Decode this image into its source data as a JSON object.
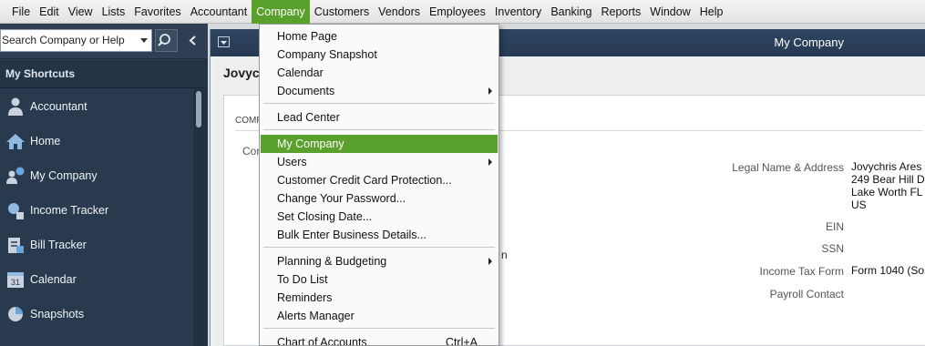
{
  "menubar": {
    "items": [
      "File",
      "Edit",
      "View",
      "Lists",
      "Favorites",
      "Accountant",
      "Company",
      "Customers",
      "Vendors",
      "Employees",
      "Inventory",
      "Banking",
      "Reports",
      "Window",
      "Help"
    ],
    "active": "Company",
    "active_color": "#5aa02c"
  },
  "leftnav": {
    "search_placeholder": "Search Company or Help",
    "shortcuts_title": "My Shortcuts",
    "items": [
      {
        "label": "Accountant",
        "icon": "person-icon"
      },
      {
        "label": "Home",
        "icon": "house-icon"
      },
      {
        "label": "My Company",
        "icon": "company-people-icon"
      },
      {
        "label": "Income Tracker",
        "icon": "income-tracker-icon"
      },
      {
        "label": "Bill Tracker",
        "icon": "bill-tracker-icon"
      },
      {
        "label": "Calendar",
        "icon": "calendar-icon"
      },
      {
        "label": "Snapshots",
        "icon": "pie-chart-icon"
      }
    ],
    "calendar_icon_text": "31"
  },
  "window": {
    "title": "My Company",
    "heading": "Jovych",
    "section_title": "COMP",
    "label_fragment": "Cor",
    "body_fragment": "n",
    "info": {
      "legal_name_label": "Legal Name & Address",
      "legal_name_lines": [
        "Jovychris Ares",
        "249 Bear Hill D",
        "Lake Worth FL",
        "US"
      ],
      "ein_label": "EIN",
      "ssn_label": "SSN",
      "income_tax_form_label": "Income Tax Form",
      "income_tax_form_value": "Form 1040 (So",
      "payroll_contact_label": "Payroll Contact"
    }
  },
  "company_menu": {
    "items": [
      {
        "label": "Home Page",
        "submenu": false
      },
      {
        "label": "Company Snapshot",
        "submenu": false
      },
      {
        "label": "Calendar",
        "submenu": false
      },
      {
        "label": "Documents",
        "submenu": true
      },
      {
        "label": "Lead Center",
        "submenu": false
      },
      {
        "label": "My Company",
        "submenu": false,
        "highlighted": true
      },
      {
        "label": "Users",
        "submenu": true
      },
      {
        "label": "Customer Credit Card Protection...",
        "submenu": false
      },
      {
        "label": "Change Your Password...",
        "submenu": false
      },
      {
        "label": "Set Closing Date...",
        "submenu": false
      },
      {
        "label": "Bulk Enter Business Details...",
        "submenu": false
      },
      {
        "label": "Planning & Budgeting",
        "submenu": true
      },
      {
        "label": "To Do List",
        "submenu": false
      },
      {
        "label": "Reminders",
        "submenu": false
      },
      {
        "label": "Alerts Manager",
        "submenu": false
      },
      {
        "label": "Chart of Accounts",
        "submenu": false,
        "shortcut": "Ctrl+A"
      }
    ]
  }
}
